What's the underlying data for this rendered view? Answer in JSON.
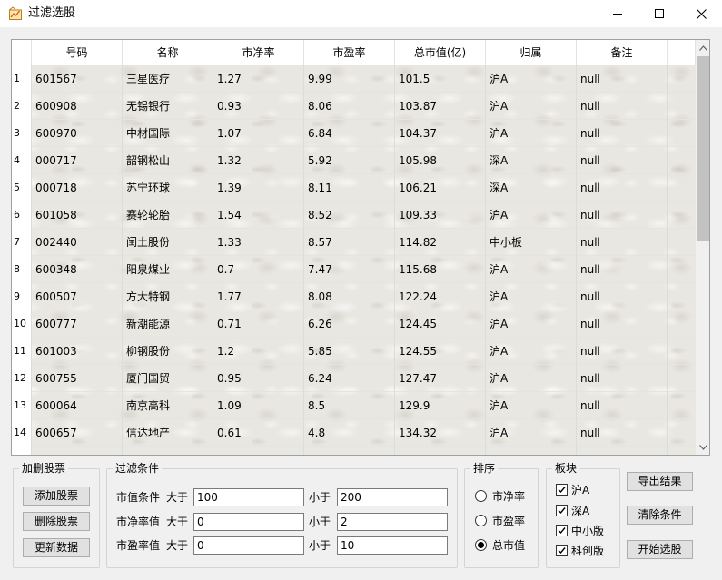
{
  "window": {
    "title": "过滤选股"
  },
  "table": {
    "columns": [
      "号码",
      "名称",
      "市净率",
      "市盈率",
      "总市值(亿)",
      "归属",
      "备注"
    ],
    "rows": [
      {
        "n": "1",
        "code": "601567",
        "name": "三星医疗",
        "pb": "1.27",
        "pe": "9.99",
        "cap": "101.5",
        "exch": "沪A",
        "note": "null"
      },
      {
        "n": "2",
        "code": "600908",
        "name": "无锡银行",
        "pb": "0.93",
        "pe": "8.06",
        "cap": "103.87",
        "exch": "沪A",
        "note": "null"
      },
      {
        "n": "3",
        "code": "600970",
        "name": "中材国际",
        "pb": "1.07",
        "pe": "6.84",
        "cap": "104.37",
        "exch": "沪A",
        "note": "null"
      },
      {
        "n": "4",
        "code": "000717",
        "name": "韶钢松山",
        "pb": "1.32",
        "pe": "5.92",
        "cap": "105.98",
        "exch": "深A",
        "note": "null"
      },
      {
        "n": "5",
        "code": "000718",
        "name": "苏宁环球",
        "pb": "1.39",
        "pe": "8.11",
        "cap": "106.21",
        "exch": "深A",
        "note": "null"
      },
      {
        "n": "6",
        "code": "601058",
        "name": "赛轮轮胎",
        "pb": "1.54",
        "pe": "8.52",
        "cap": "109.33",
        "exch": "沪A",
        "note": "null"
      },
      {
        "n": "7",
        "code": "002440",
        "name": "闰土股份",
        "pb": "1.33",
        "pe": "8.57",
        "cap": "114.82",
        "exch": "中小板",
        "note": "null"
      },
      {
        "n": "8",
        "code": "600348",
        "name": "阳泉煤业",
        "pb": "0.7",
        "pe": "7.47",
        "cap": "115.68",
        "exch": "沪A",
        "note": "null"
      },
      {
        "n": "9",
        "code": "600507",
        "name": "方大特钢",
        "pb": "1.77",
        "pe": "8.08",
        "cap": "122.24",
        "exch": "沪A",
        "note": "null"
      },
      {
        "n": "10",
        "code": "600777",
        "name": "新潮能源",
        "pb": "0.71",
        "pe": "6.26",
        "cap": "124.45",
        "exch": "沪A",
        "note": "null"
      },
      {
        "n": "11",
        "code": "601003",
        "name": "柳钢股份",
        "pb": "1.2",
        "pe": "5.85",
        "cap": "124.55",
        "exch": "沪A",
        "note": "null"
      },
      {
        "n": "12",
        "code": "600755",
        "name": "厦门国贸",
        "pb": "0.95",
        "pe": "6.24",
        "cap": "127.47",
        "exch": "沪A",
        "note": "null"
      },
      {
        "n": "13",
        "code": "600064",
        "name": "南京高科",
        "pb": "1.09",
        "pe": "8.5",
        "cap": "129.9",
        "exch": "沪A",
        "note": "null"
      },
      {
        "n": "14",
        "code": "600657",
        "name": "信达地产",
        "pb": "0.61",
        "pe": "4.8",
        "cap": "134.32",
        "exch": "沪A",
        "note": "null"
      }
    ]
  },
  "add_delete": {
    "title": "加删股票",
    "add": "添加股票",
    "delete": "删除股票",
    "update": "更新数据"
  },
  "filter": {
    "title": "过滤条件",
    "rows": [
      {
        "label": "市值条件",
        "gt": "大于",
        "gt_value": "100",
        "lt": "小于",
        "lt_value": "200"
      },
      {
        "label": "市净率值",
        "gt": "大于",
        "gt_value": "0",
        "lt": "小于",
        "lt_value": "2"
      },
      {
        "label": "市盈率值",
        "gt": "大于",
        "gt_value": "0",
        "lt": "小于",
        "lt_value": "10"
      }
    ]
  },
  "sort": {
    "title": "排序",
    "options": [
      "市净率",
      "市盈率",
      "总市值"
    ],
    "selected": "总市值"
  },
  "board": {
    "title": "板块",
    "options": [
      "沪A",
      "深A",
      "中小版",
      "科创版"
    ],
    "checked": [
      true,
      true,
      true,
      true
    ]
  },
  "actions": {
    "export": "导出结果",
    "clear": "清除条件",
    "start": "开始选股"
  }
}
